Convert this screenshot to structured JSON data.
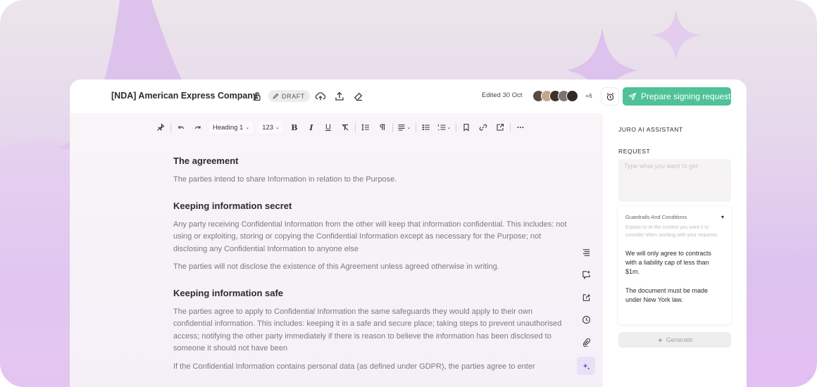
{
  "header": {
    "doc_title": "[NDA] American Express Company",
    "status_badge": "DRAFT",
    "edited": "Edited 30 Oct",
    "collaborators_extra": "+6",
    "sign_button": "Prepare signing request"
  },
  "toolbar": {
    "heading_select": "Heading 1",
    "number_select": "123",
    "bold": "B",
    "italic": "I",
    "underline": "U"
  },
  "document": {
    "sections": [
      {
        "heading": "The agreement",
        "paragraphs": [
          "The parties intend to share Information in relation to the Purpose."
        ]
      },
      {
        "heading": "Keeping information secret",
        "paragraphs": [
          "Any party receiving Confidential Information from the other will keep that information confidential. This includes: not using or exploiting, storing  or copying the Confidential Information except as necessary for the Purpose; not disclosing any Confidential Information to anyone else",
          "The parties will not disclose the existence of this Agreement unless agreed otherwise in writing."
        ]
      },
      {
        "heading": "Keeping information safe",
        "paragraphs": [
          "The parties agree to apply to Confidential Information the same safeguards they would apply to their own confidential information. This includes: keeping it in a safe and secure place; taking steps to prevent unauthorised access; notifying the other party immediately if there is reason to believe the information has been disclosed to someone it should not have been",
          "If the Confidential Information contains personal data (as defined under GDPR), the parties agree to enter"
        ]
      }
    ]
  },
  "assistant": {
    "title": "JURO AI ASSISTANT",
    "request_label": "REQUEST",
    "request_placeholder": "Type what you want to get",
    "guardrails_title": "Guardrails And Conditions",
    "guardrails_help": "Explain to AI the context you want it to consider when working with your requests.",
    "guardrails_items": [
      "We will only agree to contracts with a liability cap of less than $1m.",
      "The document must be made under New York law."
    ],
    "generate_label": "Generate"
  },
  "colors": {
    "accent_green": "#4fc297",
    "ai_purple": "#6a55c4"
  }
}
